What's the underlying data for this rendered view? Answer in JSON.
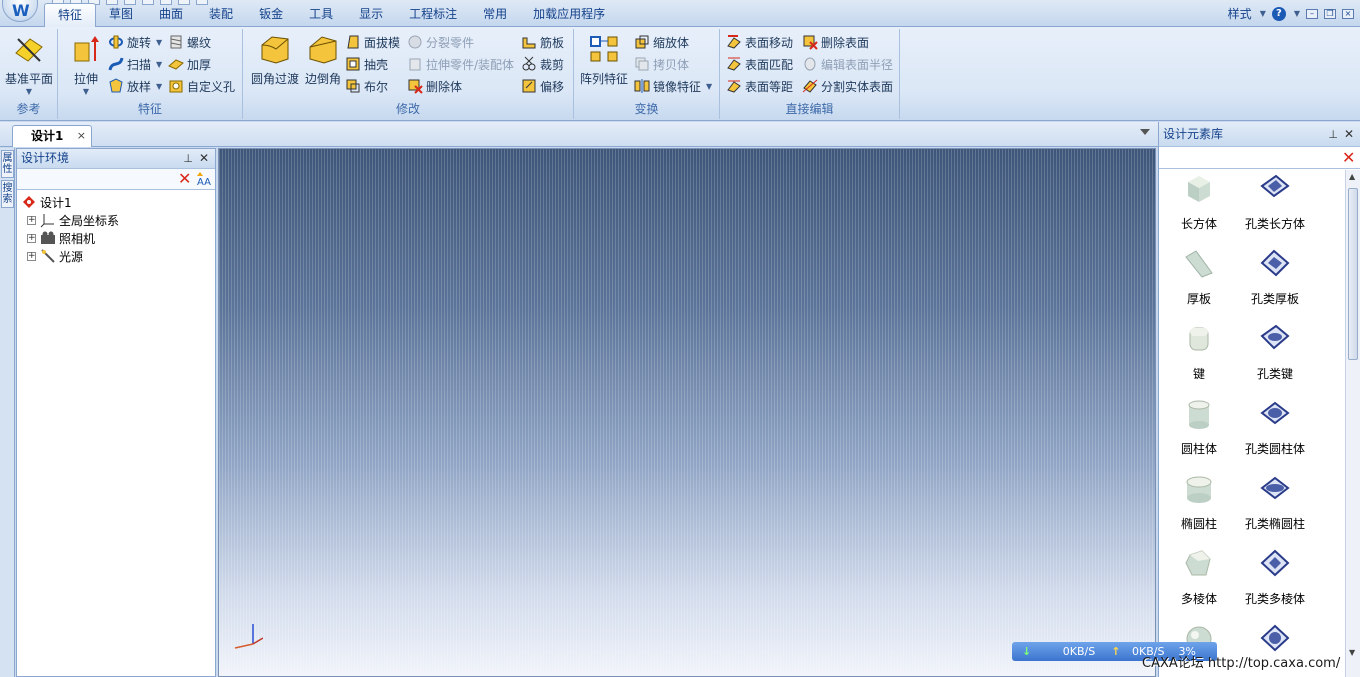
{
  "ribbon_tabs": [
    "特征",
    "草图",
    "曲面",
    "装配",
    "钣金",
    "工具",
    "显示",
    "工程标注",
    "常用",
    "加载应用程序"
  ],
  "active_tab": "特征",
  "top_right": {
    "style_label": "样式",
    "help_icon": "?"
  },
  "groups": {
    "reference": {
      "title": "参考",
      "datum_plane": "基准平面"
    },
    "feature": {
      "title": "特征",
      "extrude": "拉伸",
      "revolve": "旋转",
      "sweep": "扫描",
      "loft": "放样",
      "thread": "螺纹",
      "thicken": "加厚",
      "custom_hole": "自定义孔"
    },
    "modify": {
      "title": "修改",
      "fillet": "圆角过渡",
      "chamfer": "边倒角",
      "draft": "面拔模",
      "shell": "抽壳",
      "boolean": "布尔",
      "split_part": "分裂零件",
      "pull_part": "拉伸零件/装配体",
      "delete_body": "删除体",
      "rib": "筋板",
      "trim": "裁剪",
      "offset": "偏移"
    },
    "transform": {
      "title": "变换",
      "pattern": "阵列特征",
      "scale": "缩放体",
      "copy": "拷贝体",
      "mirror": "镜像特征"
    },
    "direct_edit": {
      "title": "直接编辑",
      "move_face": "表面移动",
      "match_face": "表面匹配",
      "offset_face": "表面等距",
      "delete_face": "删除表面",
      "edit_radius": "编辑表面半径",
      "split_solid_face": "分割实体表面"
    }
  },
  "document_tab": {
    "title": "设计1",
    "close": "×"
  },
  "left_vertical_tabs": [
    "属性",
    "搜索"
  ],
  "tree_panel": {
    "title": "设计环境",
    "nodes": [
      {
        "label": "设计1"
      },
      {
        "label": "全局坐标系"
      },
      {
        "label": "照相机"
      },
      {
        "label": "光源"
      }
    ]
  },
  "library_panel": {
    "title": "设计元素库",
    "items": [
      [
        "长方体",
        "孔类长方体"
      ],
      [
        "厚板",
        "孔类厚板"
      ],
      [
        "键",
        "孔类键"
      ],
      [
        "圆柱体",
        "孔类圆柱体"
      ],
      [
        "椭圆柱",
        "孔类椭圆柱"
      ],
      [
        "多棱体",
        "孔类多棱体"
      ]
    ]
  },
  "netspeed": {
    "down": "0KB/S",
    "up": "0KB/S",
    "percent": "3%"
  },
  "watermark": "CAXA论坛  http://top.caxa.com/",
  "colors": {
    "accent": "#15428b",
    "delete_red": "#d8281a"
  }
}
